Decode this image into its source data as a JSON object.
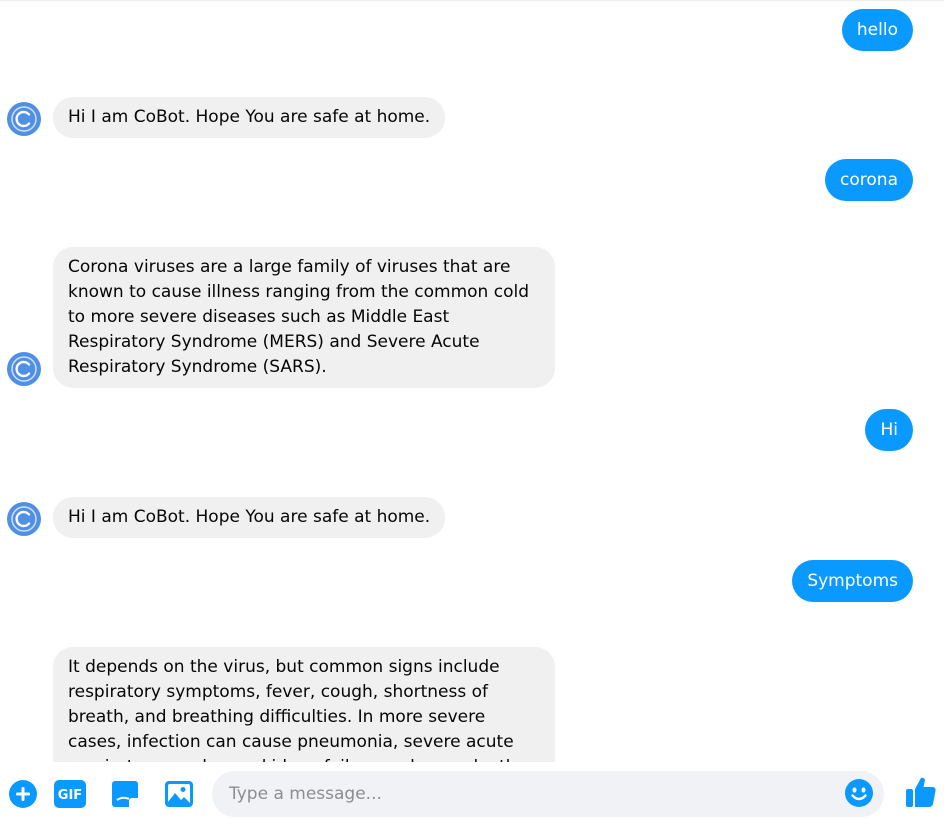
{
  "messages": [
    {
      "from": "user",
      "text": "hello"
    },
    {
      "from": "bot",
      "text": "Hi I am CoBot. Hope You are safe at home."
    },
    {
      "from": "user",
      "text": "corona"
    },
    {
      "from": "bot",
      "text": "Corona viruses are a large family of viruses that are known to cause illness ranging from the common cold to more severe diseases such as Middle East Respiratory Syndrome (MERS) and Severe Acute Respiratory Syndrome (SARS)."
    },
    {
      "from": "user",
      "text": "Hi"
    },
    {
      "from": "bot",
      "text": "Hi I am CoBot. Hope You are safe at home."
    },
    {
      "from": "user",
      "text": "Symptoms"
    },
    {
      "from": "bot",
      "text": "It depends on the virus, but common signs include respiratory symptoms, fever, cough, shortness of breath, and breathing difficulties. In more severe cases, infection can cause pneumonia, severe acute respiratory syndrome, kidney failure and even death."
    }
  ],
  "composer": {
    "placeholder": "Type a message...",
    "gif_label": "GIF"
  },
  "colors": {
    "accent": "#0a99ff",
    "bot_bubble": "#f0f0f0",
    "avatar": "#4f8fe4"
  },
  "icons": [
    "plus-circle-icon",
    "gif-icon",
    "sticker-icon",
    "image-icon",
    "emoji-icon",
    "thumbs-up-icon"
  ]
}
